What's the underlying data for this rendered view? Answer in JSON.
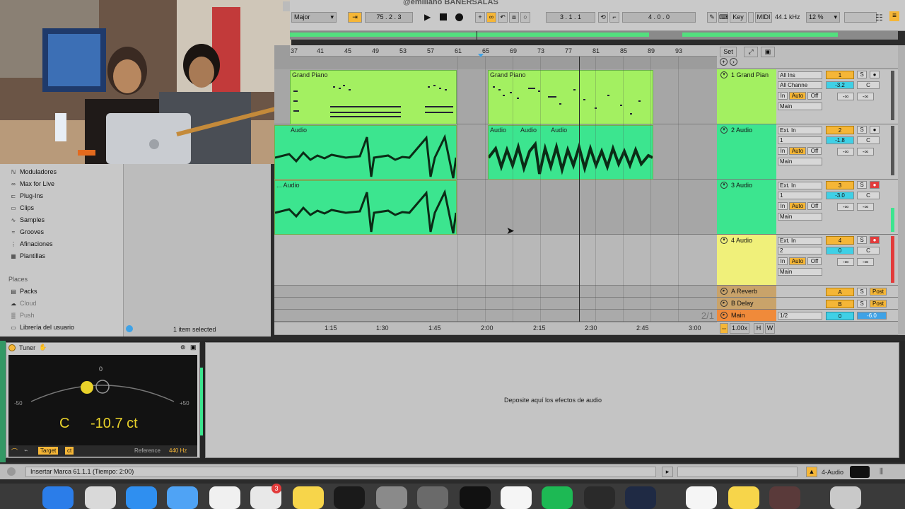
{
  "header": {
    "overlay_title": "@emiliano BANERSALAS",
    "scale": "Major",
    "position": "75 .  2 .  3",
    "loop_start": "3 .  1 .  1",
    "loop_length": "4 .  0 .  0",
    "key_label": "Key",
    "midi_label": "MIDI",
    "sample_rate": "44.1 kHz",
    "cpu": "12 %"
  },
  "ruler": {
    "bars": [
      "37",
      "41",
      "45",
      "49",
      "53",
      "57",
      "61",
      "65",
      "69",
      "73",
      "77",
      "81",
      "85",
      "89",
      "93"
    ],
    "set_label": "Set"
  },
  "time_ruler": {
    "times": [
      "1:15",
      "1:30",
      "1:45",
      "2:00",
      "2:15",
      "2:30",
      "2:45",
      "3:00"
    ],
    "zoom": "1.00x",
    "h_label": "H",
    "w_label": "W",
    "page": "2/1"
  },
  "clips": {
    "piano_1": "Grand Piano",
    "piano_2": "Grand Piano",
    "audio_a": "Audio",
    "audio_b": "Audio",
    "audio_c": "Audio",
    "audio_d": "Audio",
    "audio_e": "... Audio"
  },
  "tracks": [
    {
      "name": "1 Grand Pian",
      "input": "All Ins",
      "channel": "All Channe",
      "number": "1",
      "vol": "-3.2",
      "pan": "C",
      "out": "Main",
      "color": "#a3f061"
    },
    {
      "name": "2 Audio",
      "input": "Ext. In",
      "channel": "1",
      "number": "2",
      "vol": "-1.8",
      "pan": "C",
      "out": "Main",
      "color": "#3ce58f"
    },
    {
      "name": "3 Audio",
      "input": "Ext. In",
      "channel": "1",
      "number": "3",
      "vol": "-3.0",
      "pan": "C",
      "out": "Main",
      "color": "#3ce58f"
    },
    {
      "name": "4 Audio",
      "input": "Ext. In",
      "channel": "2",
      "number": "4",
      "vol": "0",
      "pan": "C",
      "out": "Main",
      "color": "#f0f07a"
    }
  ],
  "returns": [
    {
      "name": "A Reverb",
      "letter": "A",
      "post": "Post"
    },
    {
      "name": "B Delay",
      "letter": "B",
      "post": "Post"
    }
  ],
  "main": {
    "name": "Main",
    "ratio": "1/2",
    "number": "0",
    "vol": "-6.0"
  },
  "mix_labels": {
    "in": "In",
    "auto": "Auto",
    "off": "Off",
    "solo": "S",
    "inf": "-∞"
  },
  "browser": {
    "categories": [
      "Moduladores",
      "Max for Live",
      "Plug-Ins",
      "Clips",
      "Samples",
      "Grooves",
      "Afinaciones",
      "Plantillas"
    ],
    "places_header": "Places",
    "places": [
      "Packs",
      "Cloud",
      "Push",
      "Librería del usuario"
    ],
    "status": "1 item selected"
  },
  "tuner": {
    "title": "Tuner",
    "note": "C",
    "cents": "-10.7 ct",
    "scale_zero": "0",
    "scale_left": "-50",
    "scale_right": "+50",
    "target_label": "Target",
    "ct_label": "ct",
    "reference_label": "Reference",
    "reference_value": "440 Hz"
  },
  "dropzone": {
    "text": "Deposite aquí los efectos de audio"
  },
  "statusbar": {
    "message": "Insertar Marca 61.1.1 (Tiempo: 2:00)",
    "track": "4-Audio"
  },
  "colors": {
    "accent": "#f5b637",
    "midi_clip": "#a3f061",
    "audio_clip": "#3ce58f",
    "arm_red": "#e23b3b",
    "blue": "#3fa2e6"
  }
}
